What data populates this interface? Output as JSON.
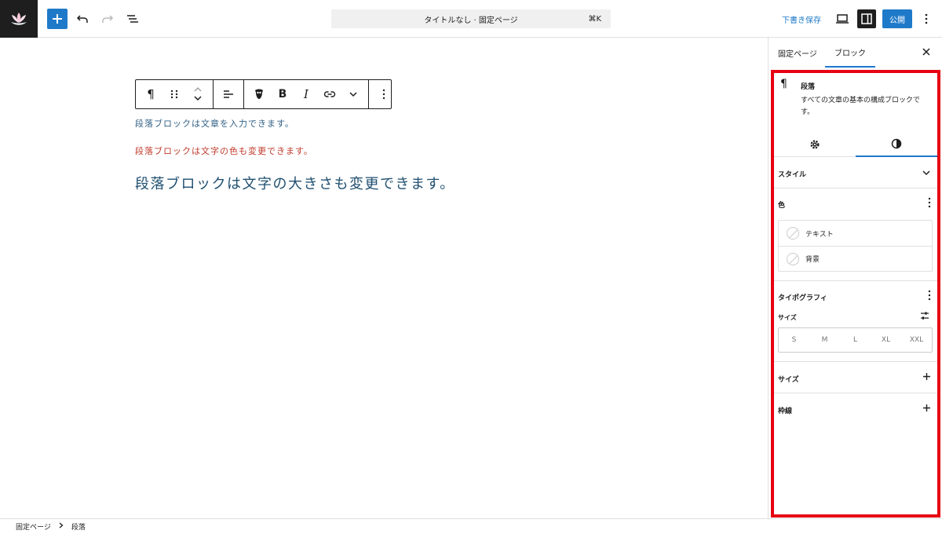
{
  "header": {
    "add_icon": "plus-icon",
    "document_title": "タイトルなし · 固定ページ",
    "shortcut": "⌘K",
    "save_draft": "下書き保存",
    "publish": "公開"
  },
  "toolbar": {
    "paragraph_icon": "¶",
    "bold": "B",
    "italic": "I"
  },
  "content": {
    "paragraphs": [
      {
        "text": "段落ブロックは文章を入力できます。",
        "color": "#2f5f84"
      },
      {
        "text": "段落ブロックは文字の色も変更できます。",
        "color": "#c0392b"
      },
      {
        "text": "段落ブロックは文字の大きさも変更できます。",
        "color": "#1f4f70"
      }
    ]
  },
  "sidebar": {
    "tabs": [
      "固定ページ",
      "ブロック"
    ],
    "block": {
      "name": "段落",
      "description": "すべての文章の基本の構成ブロックです。"
    },
    "panels": {
      "style": "スタイル",
      "color": "色",
      "color_items": [
        "テキスト",
        "背景"
      ],
      "typography": "タイポグラフィ",
      "size_label": "サイズ",
      "size_options": [
        "S",
        "M",
        "L",
        "XL",
        "XXL"
      ],
      "dimensions": "サイズ",
      "border": "枠線"
    }
  },
  "footer": {
    "breadcrumbs": [
      "固定ページ",
      "段落"
    ]
  },
  "colors": {
    "accent": "#1e7ac9",
    "highlight": "#e60012",
    "dark": "#1e1e1e"
  }
}
